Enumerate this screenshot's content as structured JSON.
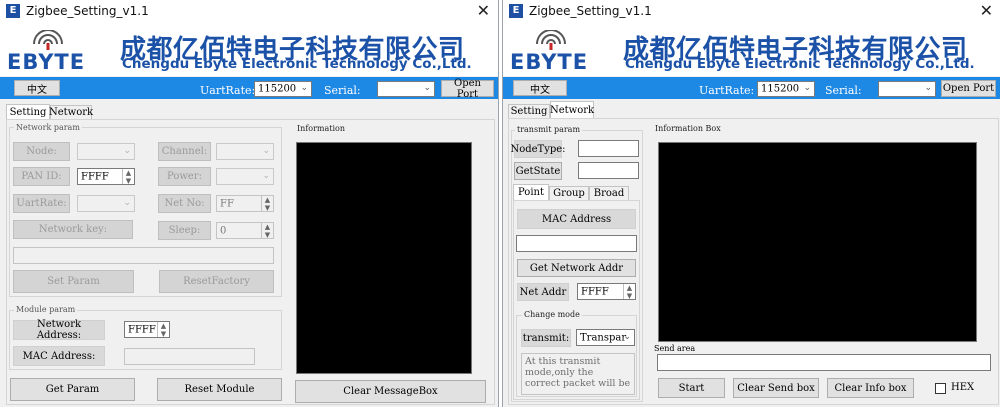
{
  "title": "Zigbee_Setting_v1.1",
  "title_icon": "E",
  "close": "✕",
  "brand": {
    "logo": "EBYTE",
    "company_cn": "成都亿佰特电子科技有限公司",
    "company_en": "Chengdu Ebyte Electronic Technology Co.,Ltd.",
    "color": "#1b52a8"
  },
  "toolbar": {
    "lang_button": "中文",
    "uart_label": "UartRate:",
    "uart_value": "115200",
    "serial_label": "Serial:",
    "serial_value": "",
    "open_port": "Open Port",
    "bar_color": "#1e88e5"
  },
  "tabs": [
    "Setting",
    "Network"
  ],
  "w1": {
    "network_param": {
      "title": "Network param",
      "node_label": "Node:",
      "channel_label": "Channel:",
      "pan_id_label": "PAN ID:",
      "pan_id_value": "FFFF",
      "power_label": "Power:",
      "uart_label": "UartRate:",
      "net_no_label": "Net No:",
      "net_no_value": "FF",
      "network_key_label": "Network key:",
      "sleep_label": "Sleep:",
      "sleep_value": "0",
      "set_param": "Set Param",
      "reset_factory": "ResetFactory"
    },
    "module_param": {
      "title": "Module param",
      "network_address_label": "Network Address:",
      "network_address_value": "FFFF",
      "mac_address_label": "MAC Address:"
    },
    "information_title": "Information",
    "get_param": "Get Param",
    "reset_module": "Reset Module",
    "clear_messagebox": "Clear MessageBox"
  },
  "w2": {
    "transmit_param": {
      "title": "transmit param",
      "nodetype_label": "NodeType:",
      "getstate_label": "GetState"
    },
    "subtabs": [
      "Point",
      "Group",
      "Broad"
    ],
    "mac_address_label": "MAC Address",
    "get_network_addr": "Get Network Addr",
    "net_addr_label": "Net Addr",
    "net_addr_value": "FFFF",
    "change_mode": {
      "title": "Change mode",
      "transmit_label": "transmit:",
      "transmit_value": "Transpar"
    },
    "hint": "At this transmit mode,only the correct packet will be",
    "information_box_title": "Information Box",
    "send_area_label": "Send area",
    "start": "Start",
    "clear_send_box": "Clear Send box",
    "clear_info_box": "Clear Info box",
    "hex_label": "HEX"
  }
}
